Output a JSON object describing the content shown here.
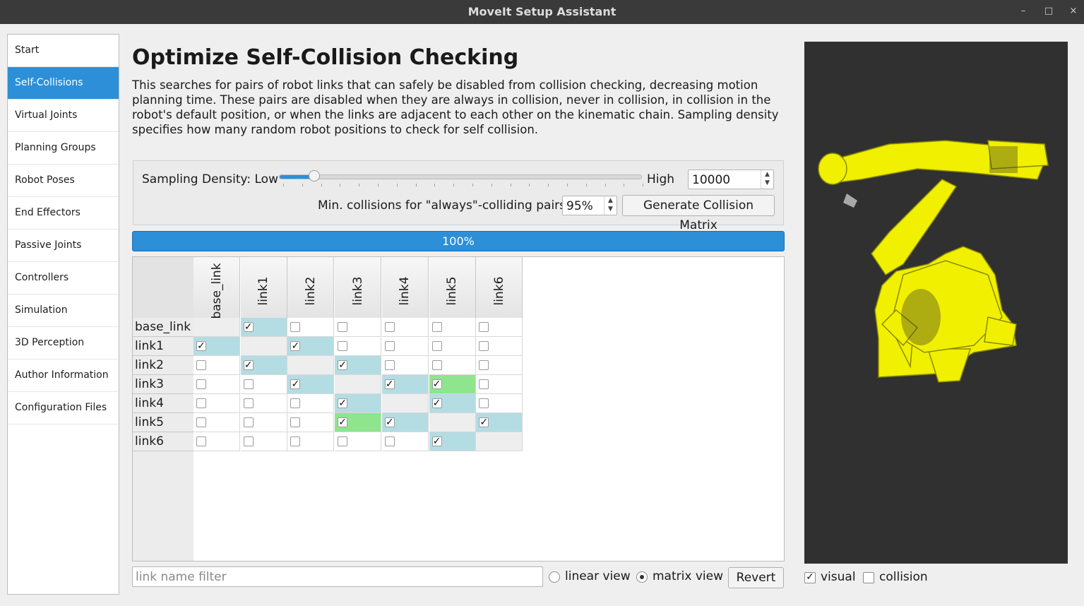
{
  "window": {
    "title": "MoveIt Setup Assistant",
    "controls": [
      "–",
      "□",
      "×"
    ]
  },
  "sidebar": {
    "items": [
      {
        "label": "Start"
      },
      {
        "label": "Self-Collisions"
      },
      {
        "label": "Virtual Joints"
      },
      {
        "label": "Planning Groups"
      },
      {
        "label": "Robot Poses"
      },
      {
        "label": "End Effectors"
      },
      {
        "label": "Passive Joints"
      },
      {
        "label": "Controllers"
      },
      {
        "label": "Simulation"
      },
      {
        "label": "3D Perception"
      },
      {
        "label": "Author Information"
      },
      {
        "label": "Configuration Files"
      }
    ],
    "active_index": 1
  },
  "page": {
    "title": "Optimize Self-Collision Checking",
    "description": "This searches for pairs of robot links that can safely be disabled from collision checking, decreasing motion planning time. These pairs are disabled when they are always in collision, never in collision, in collision in the robot's default position, or when the links are adjacent to each other on the kinematic chain. Sampling density specifies how many random robot positions to check for self collision."
  },
  "sampling": {
    "label_low": "Sampling Density: Low",
    "label_high": "High",
    "slider_fraction": 0.1,
    "density_value": "10000",
    "min_collisions_label": "Min. collisions for \"always\"-colliding pairs:",
    "min_collisions_value": "95%",
    "generate_button": "Generate Collision Matrix"
  },
  "progress": {
    "value": 100,
    "text": "100%"
  },
  "matrix": {
    "links": [
      "base_link",
      "link1",
      "link2",
      "link3",
      "link4",
      "link5",
      "link6"
    ],
    "checked": [
      [
        0,
        1,
        0,
        0,
        0,
        0,
        0
      ],
      [
        1,
        0,
        1,
        0,
        0,
        0,
        0
      ],
      [
        0,
        1,
        0,
        1,
        0,
        0,
        0
      ],
      [
        0,
        0,
        1,
        0,
        1,
        1,
        0
      ],
      [
        0,
        0,
        0,
        1,
        0,
        1,
        0
      ],
      [
        0,
        0,
        0,
        1,
        1,
        0,
        1
      ],
      [
        0,
        0,
        0,
        0,
        0,
        1,
        0
      ]
    ],
    "highlight": [
      [
        "",
        "blue",
        "",
        "",
        "",
        "",
        ""
      ],
      [
        "blue",
        "",
        "blue",
        "",
        "",
        "",
        ""
      ],
      [
        "",
        "blue",
        "",
        "blue",
        "",
        "",
        ""
      ],
      [
        "",
        "",
        "blue",
        "",
        "blue",
        "green",
        ""
      ],
      [
        "",
        "",
        "",
        "blue",
        "",
        "blue",
        ""
      ],
      [
        "",
        "",
        "",
        "green",
        "blue",
        "",
        "blue"
      ],
      [
        "",
        "",
        "",
        "",
        "",
        "blue",
        ""
      ]
    ],
    "colors": {
      "adjacent": "#b4dde3",
      "default": "#8ee58e",
      "diagonal": "#eeeeee"
    }
  },
  "bottom": {
    "filter_placeholder": "link name filter",
    "linear_view": "linear view",
    "matrix_view": "matrix view",
    "selected_view": "matrix",
    "revert_button": "Revert"
  },
  "viewer": {
    "visual_label": "visual",
    "visual_checked": true,
    "collision_label": "collision",
    "collision_checked": false,
    "robot_color": "#f0f000"
  },
  "colors": {
    "accent": "#2c8fd8",
    "titlebar": "#3a3a3a",
    "viewport": "#303030"
  }
}
